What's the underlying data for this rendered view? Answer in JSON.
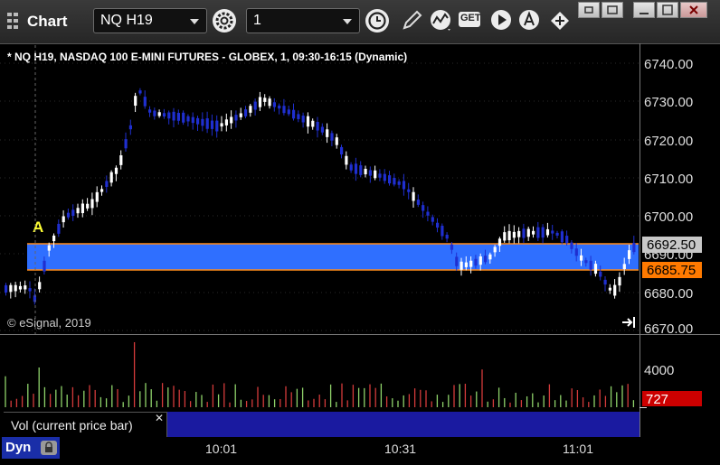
{
  "toolbar": {
    "app_title": "Chart",
    "symbol_value": "NQ H19",
    "interval_value": "1",
    "get_label": "GET"
  },
  "chart": {
    "header": "* NQ H19, NASDAQ 100 E-MINI FUTURES - GLOBEX, 1, 09:30-16:15 (Dynamic)",
    "copyright": "© eSignal, 2019",
    "marker_label": "A",
    "price_ticks": [
      "6740.00",
      "6730.00",
      "6720.00",
      "6710.00",
      "6700.00",
      "6690.00",
      "6680.00",
      "6670.00"
    ],
    "upper_band_price": "6692.50",
    "lower_band_price": "6685.75",
    "volume_tick": "4000",
    "volume_value": "727",
    "volume_label": "Vol (current price bar)",
    "time_ticks": [
      "10:01",
      "10:31",
      "11:01"
    ],
    "footer_tab": "Dyn",
    "colors": {
      "band_fill": "#2f6fff",
      "band_line": "#ff8c1a",
      "up_candle": "#ffffff",
      "down_candle": "#1f2fd0",
      "volume_up": "#8fd36a",
      "volume_down": "#d43b3b",
      "volume_badge": "#cc0000",
      "upper_badge": "#c8c8c8",
      "lower_badge": "#ff7a00"
    }
  }
}
